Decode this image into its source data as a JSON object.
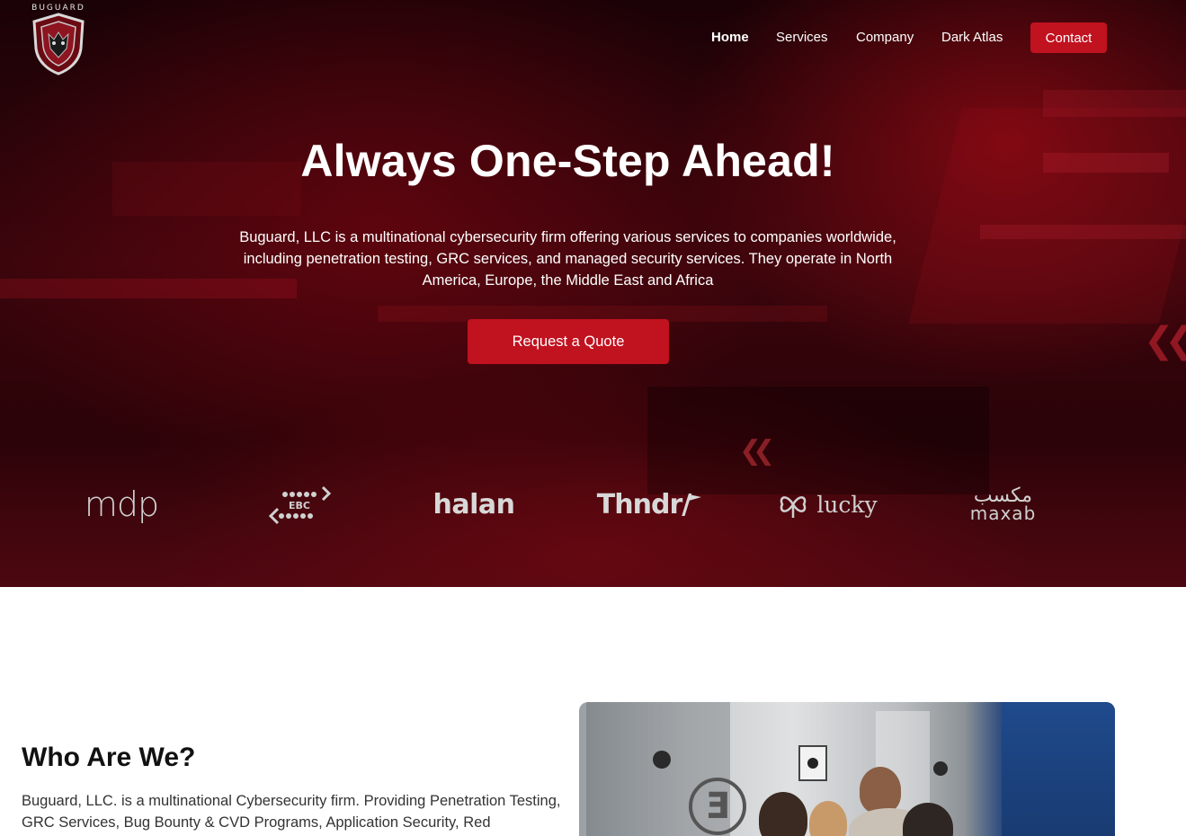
{
  "brand": {
    "name": "BUGUARD"
  },
  "nav": {
    "items": [
      {
        "label": "Home"
      },
      {
        "label": "Services"
      },
      {
        "label": "Company"
      },
      {
        "label": "Dark Atlas"
      }
    ],
    "contact_label": "Contact"
  },
  "hero": {
    "title": "Always One-Step Ahead!",
    "description": "Buguard, LLC is a multinational cybersecurity firm offering various services to companies worldwide, including penetration testing, GRC services, and managed security services. They operate in North America, Europe, the Middle East and Africa",
    "cta_label": "Request a Quote"
  },
  "clients": [
    {
      "name": "mdp",
      "icon": "mdp-logo"
    },
    {
      "name": "EBC",
      "icon": "ebc-logo"
    },
    {
      "name": "halan",
      "icon": "halan-logo"
    },
    {
      "name": "Thndr/",
      "icon": "thndr-logo"
    },
    {
      "name": "lucky",
      "icon": "lucky-logo"
    },
    {
      "name": "maxab",
      "name_ar": "مكسب",
      "icon": "maxab-logo"
    }
  ],
  "about": {
    "title": "Who Are We?",
    "text": "Buguard, LLC. is a multinational Cybersecurity firm. Providing Penetration Testing, GRC Services, Bug Bounty & CVD Programs, Application Security, Red"
  },
  "colors": {
    "accent": "#c1121f",
    "hero_dark": "#1a0206",
    "hero_red": "#3a050c",
    "text_dark": "#111111",
    "text_body": "#333333"
  }
}
